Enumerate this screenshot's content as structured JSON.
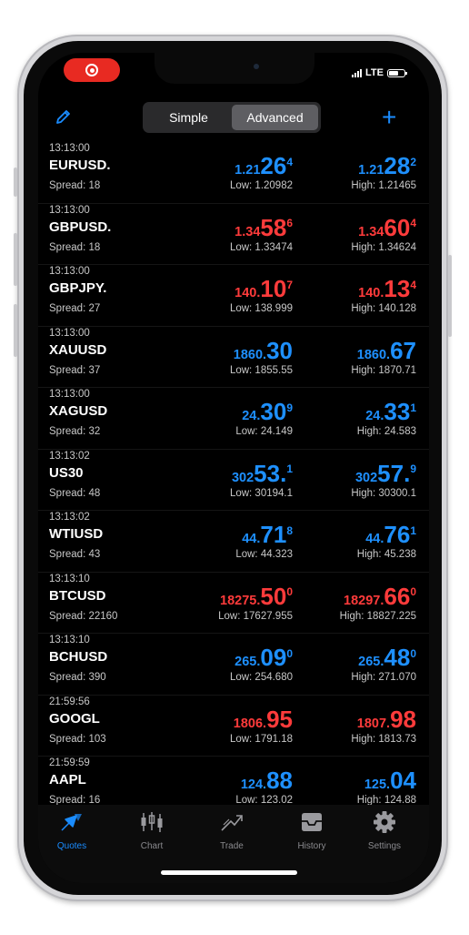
{
  "status_bar": {
    "network": "LTE"
  },
  "toolbar": {
    "segments": [
      "Simple",
      "Advanced"
    ],
    "active_segment": "Advanced",
    "plus_label": "+"
  },
  "quotes": [
    {
      "time": "13:13:00",
      "symbol": "EURUSD.",
      "spread": "Spread: 18",
      "bid_prefix": "1.21",
      "bid_big": "26",
      "bid_sup": "4",
      "bid_color": "blue",
      "ask_prefix": "1.21",
      "ask_big": "28",
      "ask_sup": "2",
      "ask_color": "blue",
      "low": "Low: 1.20982",
      "high": "High: 1.21465"
    },
    {
      "time": "13:13:00",
      "symbol": "GBPUSD.",
      "spread": "Spread: 18",
      "bid_prefix": "1.34",
      "bid_big": "58",
      "bid_sup": "6",
      "bid_color": "red",
      "ask_prefix": "1.34",
      "ask_big": "60",
      "ask_sup": "4",
      "ask_color": "red",
      "low": "Low: 1.33474",
      "high": "High: 1.34624"
    },
    {
      "time": "13:13:00",
      "symbol": "GBPJPY.",
      "spread": "Spread: 27",
      "bid_prefix": "140.",
      "bid_big": "10",
      "bid_sup": "7",
      "bid_color": "red",
      "ask_prefix": "140.",
      "ask_big": "13",
      "ask_sup": "4",
      "ask_color": "red",
      "low": "Low: 138.999",
      "high": "High: 140.128"
    },
    {
      "time": "13:13:00",
      "symbol": "XAUUSD",
      "spread": "Spread: 37",
      "bid_prefix": "1860.",
      "bid_big": "30",
      "bid_sup": "",
      "bid_color": "blue",
      "ask_prefix": "1860.",
      "ask_big": "67",
      "ask_sup": "",
      "ask_color": "blue",
      "low": "Low: 1855.55",
      "high": "High: 1870.71"
    },
    {
      "time": "13:13:00",
      "symbol": "XAGUSD",
      "spread": "Spread: 32",
      "bid_prefix": "24.",
      "bid_big": "30",
      "bid_sup": "9",
      "bid_color": "blue",
      "ask_prefix": "24.",
      "ask_big": "33",
      "ask_sup": "1",
      "ask_color": "blue",
      "low": "Low: 24.149",
      "high": "High: 24.583"
    },
    {
      "time": "13:13:02",
      "symbol": "US30",
      "spread": "Spread: 48",
      "bid_prefix": "302",
      "bid_big": "53.",
      "bid_sup": "1",
      "bid_color": "blue",
      "ask_prefix": "302",
      "ask_big": "57.",
      "ask_sup": "9",
      "ask_color": "blue",
      "low": "Low: 30194.1",
      "high": "High: 30300.1"
    },
    {
      "time": "13:13:02",
      "symbol": "WTIUSD",
      "spread": "Spread: 43",
      "bid_prefix": "44.",
      "bid_big": "71",
      "bid_sup": "8",
      "bid_color": "blue",
      "ask_prefix": "44.",
      "ask_big": "76",
      "ask_sup": "1",
      "ask_color": "blue",
      "low": "Low: 44.323",
      "high": "High: 45.238"
    },
    {
      "time": "13:13:10",
      "symbol": "BTCUSD",
      "spread": "Spread: 22160",
      "bid_prefix": "18275.",
      "bid_big": "50",
      "bid_sup": "0",
      "bid_color": "red",
      "ask_prefix": "18297.",
      "ask_big": "66",
      "ask_sup": "0",
      "ask_color": "red",
      "low": "Low: 17627.955",
      "high": "High: 18827.225"
    },
    {
      "time": "13:13:10",
      "symbol": "BCHUSD",
      "spread": "Spread: 390",
      "bid_prefix": "265.",
      "bid_big": "09",
      "bid_sup": "0",
      "bid_color": "blue",
      "ask_prefix": "265.",
      "ask_big": "48",
      "ask_sup": "0",
      "ask_color": "blue",
      "low": "Low: 254.680",
      "high": "High: 271.070"
    },
    {
      "time": "21:59:56",
      "symbol": "GOOGL",
      "spread": "Spread: 103",
      "bid_prefix": "1806.",
      "bid_big": "95",
      "bid_sup": "",
      "bid_color": "red",
      "ask_prefix": "1807.",
      "ask_big": "98",
      "ask_sup": "",
      "ask_color": "red",
      "low": "Low: 1791.18",
      "high": "High: 1813.73"
    },
    {
      "time": "21:59:59",
      "symbol": "AAPL",
      "spread": "Spread: 16",
      "bid_prefix": "124.",
      "bid_big": "88",
      "bid_sup": "",
      "bid_color": "blue",
      "ask_prefix": "125.",
      "ask_big": "04",
      "ask_sup": "",
      "ask_color": "blue",
      "low": "Low: 123.02",
      "high": "High: 124.88"
    }
  ],
  "tabs": [
    {
      "label": "Quotes",
      "icon": "quotes-icon",
      "active": true
    },
    {
      "label": "Chart",
      "icon": "chart-icon",
      "active": false
    },
    {
      "label": "Trade",
      "icon": "trade-icon",
      "active": false
    },
    {
      "label": "History",
      "icon": "history-icon",
      "active": false
    },
    {
      "label": "Settings",
      "icon": "settings-icon",
      "active": false
    }
  ],
  "colors": {
    "blue": "#1e90ff",
    "red": "#ff3b3b",
    "accent": "#1a8cff",
    "recording": "#e82a22"
  }
}
